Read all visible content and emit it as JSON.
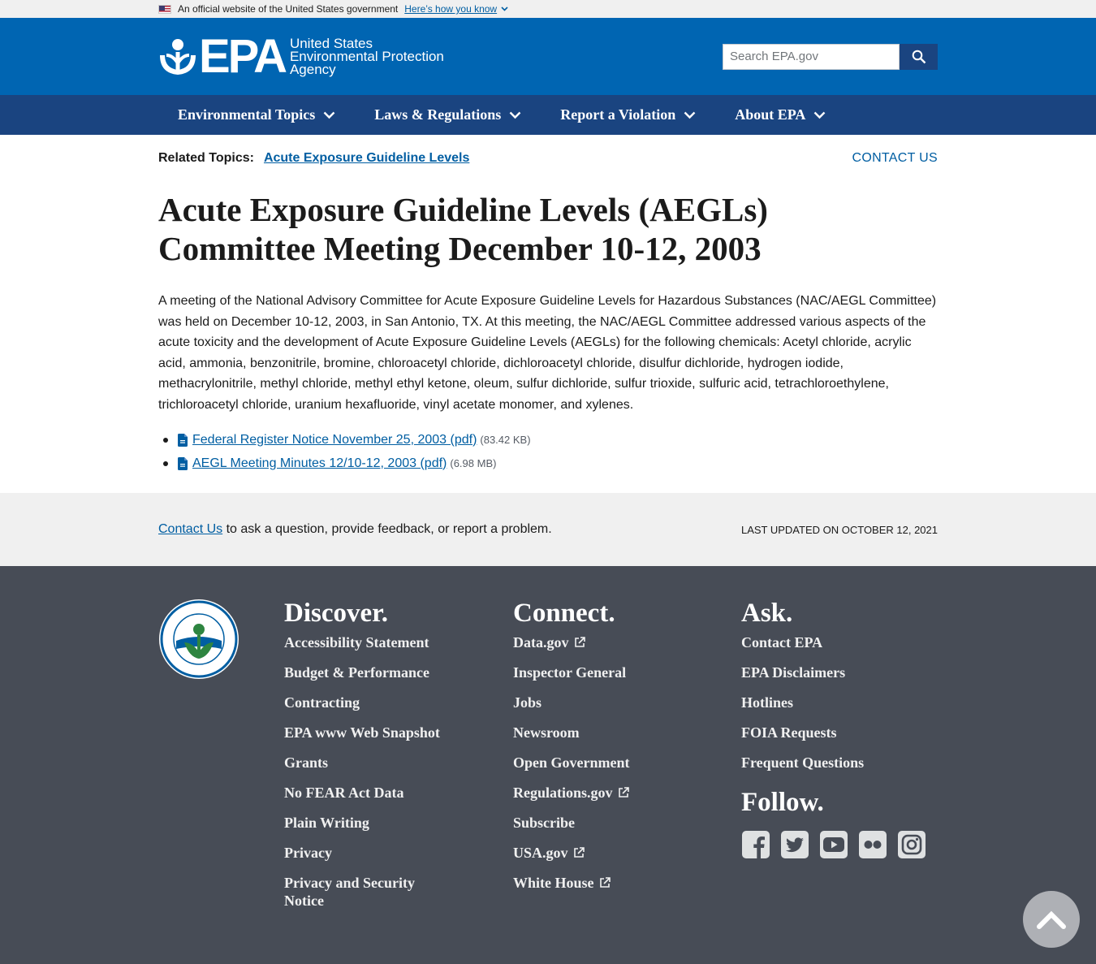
{
  "gov_banner": {
    "text": "An official website of the United States government",
    "link": "Here’s how you know"
  },
  "header": {
    "logo_letters": "EPA",
    "logo_line1": "United States",
    "logo_line2": "Environmental Protection",
    "logo_line3": "Agency",
    "search_placeholder": "Search EPA.gov"
  },
  "nav": {
    "items": [
      {
        "label": "Environmental Topics"
      },
      {
        "label": "Laws & Regulations"
      },
      {
        "label": "Report a Violation"
      },
      {
        "label": "About EPA"
      }
    ]
  },
  "related": {
    "label": "Related Topics:",
    "link": "Acute Exposure Guideline Levels",
    "contact": "CONTACT US"
  },
  "main": {
    "title_line1": "Acute Exposure Guideline Levels (AEGLs)",
    "title_line2": "Committee Meeting December 10-12, 2003",
    "intro": "A meeting of the National Advisory Committee for Acute Exposure Guideline Levels for Hazardous Substances (NAC/AEGL Committee) was held on December 10-12, 2003, in San Antonio, TX. At this meeting, the NAC/AEGL Committee addressed various aspects of the acute toxicity and the development of Acute Exposure Guideline Levels (AEGLs) for the following chemicals: Acetyl chloride, acrylic acid, ammonia, benzonitrile, bromine, chloroacetyl chloride, dichloroacetyl chloride, disulfur dichloride, hydrogen iodide, methacrylonitrile, methyl chloride, methyl ethyl ketone, oleum, sulfur dichloride, sulfur trioxide, sulfuric acid, tetrachloroethylene, trichloroacetyl chloride, uranium hexafluoride, vinyl acetate monomer, and xylenes.",
    "files": [
      {
        "label": "Federal Register Notice November 25, 2003 (pdf)",
        "size": "(83.42 KB)"
      },
      {
        "label": "AEGL Meeting Minutes 12/10-12, 2003 (pdf)",
        "size": "(6.98 MB)"
      }
    ]
  },
  "feedback": {
    "link": "Contact Us",
    "text": " to ask a question, provide feedback, or report a problem.",
    "updated": "Last updated on October 12, 2021"
  },
  "footer": {
    "discover": {
      "title": "Discover.",
      "links": [
        "Accessibility Statement",
        "Budget & Performance",
        "Contracting",
        "EPA www Web Snapshot",
        "Grants",
        "No FEAR Act Data",
        "Plain Writing",
        "Privacy",
        "Privacy and Security Notice"
      ]
    },
    "connect": {
      "title": "Connect.",
      "links": [
        "Data.gov",
        "Inspector General",
        "Jobs",
        "Newsroom",
        "Open Government",
        "Regulations.gov",
        "Subscribe",
        "USA.gov",
        "White House"
      ]
    },
    "ask": {
      "title": "Ask.",
      "links": [
        "Contact EPA",
        "EPA Disclaimers",
        "Hotlines",
        "FOIA Requests",
        "Frequent Questions"
      ]
    },
    "follow": {
      "title": "Follow.",
      "icons": [
        "facebook-icon",
        "twitter-icon",
        "youtube-icon",
        "flickr-icon",
        "instagram-icon"
      ]
    }
  },
  "colors": {
    "header_blue": "#0065b2",
    "nav_blue": "#1a4480",
    "link_blue": "#005ea2",
    "footer_gray": "#474c56"
  }
}
